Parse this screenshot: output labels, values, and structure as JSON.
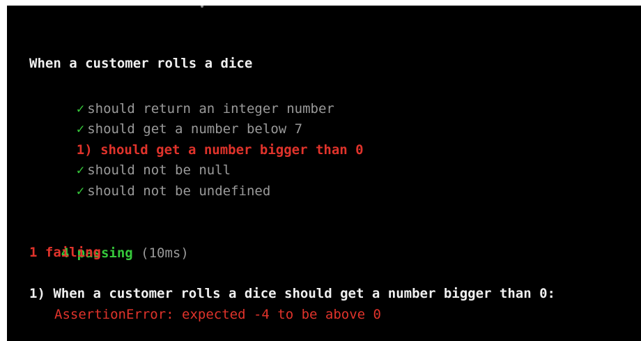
{
  "suite": {
    "title": "When a customer rolls a dice"
  },
  "tests": [
    {
      "status": "pass",
      "mark": "✓",
      "label": "should return an integer number"
    },
    {
      "status": "pass",
      "mark": "✓",
      "label": "should get a number below 7"
    },
    {
      "status": "fail",
      "mark": "1)",
      "label": "should get a number bigger than 0"
    },
    {
      "status": "pass",
      "mark": "✓",
      "label": "should not be null"
    },
    {
      "status": "pass",
      "mark": "✓",
      "label": "should not be undefined"
    }
  ],
  "summary": {
    "passing": "4 passing",
    "duration": "(10ms)",
    "failing": "1 failing"
  },
  "failure_detail": {
    "title": "1) When a customer rolls a dice should get a number bigger than 0:",
    "error": "AssertionError: expected -4 to be above 0"
  },
  "colors": {
    "background": "#000000",
    "pass": "#36c93b",
    "fail": "#e0332b",
    "muted": "#9a9a9a",
    "text": "#f0f0f0"
  }
}
